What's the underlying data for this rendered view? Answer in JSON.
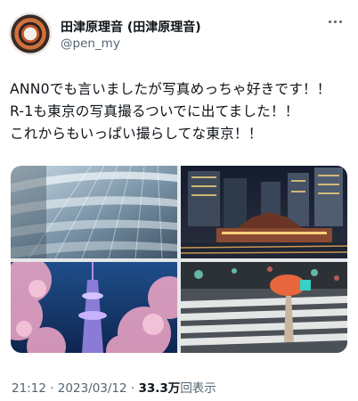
{
  "author": {
    "display_name": "田津原理音 (田津原理音)",
    "handle": "@pen_my"
  },
  "tweet": {
    "lines": [
      "ANN0でも言いましたが写真めっちゃ好きです！！",
      "R-1も東京の写真撮るついでに出てました！！",
      "これからもいっぱい撮らしてな東京！！"
    ]
  },
  "media": {
    "images": [
      "glass-atrium-photo",
      "tokyo-station-night-photo",
      "skytree-cherry-blossom-photo",
      "crosswalk-umbrella-photo"
    ]
  },
  "meta": {
    "time": "21:12",
    "date": "2023/03/12",
    "separator": "·",
    "views_count": "33.3万",
    "views_label": "回表示"
  },
  "icons": {
    "more": "more-horizontal-icon"
  }
}
